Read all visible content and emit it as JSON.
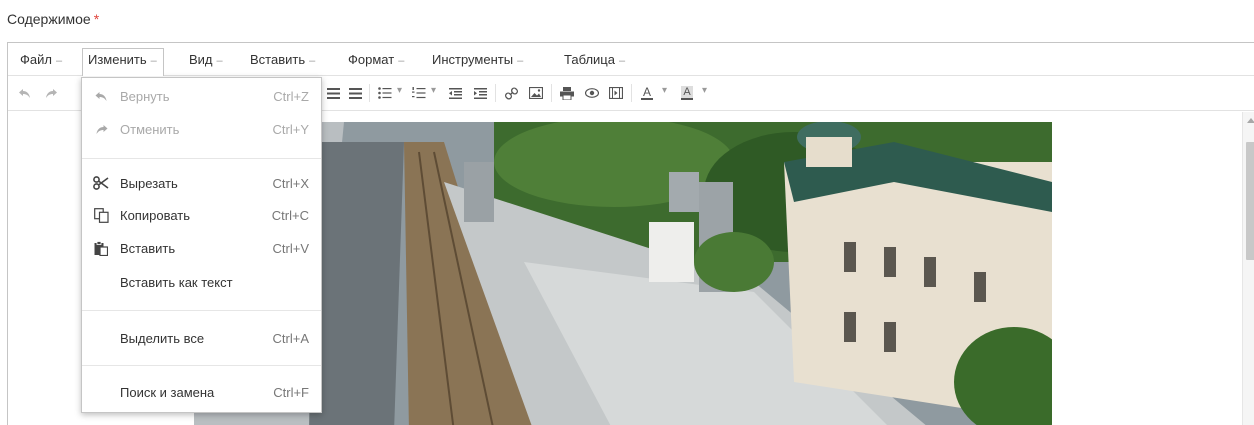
{
  "field": {
    "label": "Содержимое",
    "required_mark": "*"
  },
  "menubar": {
    "items": [
      {
        "label": "Файл",
        "caret": "–"
      },
      {
        "label": "Изменить",
        "caret": "–"
      },
      {
        "label": "Вид",
        "caret": "–"
      },
      {
        "label": "Вставить",
        "caret": "–"
      },
      {
        "label": "Формат",
        "caret": "–"
      },
      {
        "label": "Инструменты",
        "caret": "–"
      },
      {
        "label": "Таблица",
        "caret": "–"
      }
    ],
    "active": "Изменить"
  },
  "toolbar": {
    "buttons": [
      "undo-icon",
      "redo-icon",
      "align-justify-icon",
      "bullet-list-icon",
      "numbered-list-icon",
      "outdent-icon",
      "indent-icon",
      "link-icon",
      "image-icon",
      "print-icon",
      "preview-icon",
      "media-icon",
      "text-color-icon",
      "background-color-icon"
    ],
    "text_color_letter": "A",
    "bg_color_letter": "A"
  },
  "edit_menu": {
    "items": [
      {
        "label": "Вернуть",
        "shortcut": "Ctrl+Z",
        "icon": "undo-icon",
        "disabled": true
      },
      {
        "label": "Отменить",
        "shortcut": "Ctrl+Y",
        "icon": "redo-icon",
        "disabled": true
      },
      {
        "label": "Вырезать",
        "shortcut": "Ctrl+X",
        "icon": "scissors-icon",
        "disabled": false
      },
      {
        "label": "Копировать",
        "shortcut": "Ctrl+C",
        "icon": "copy-icon",
        "disabled": false
      },
      {
        "label": "Вставить",
        "shortcut": "Ctrl+V",
        "icon": "paste-icon",
        "disabled": false
      },
      {
        "label": "Вставить как текст",
        "shortcut": "",
        "icon": "",
        "disabled": false
      },
      {
        "label": "Выделить все",
        "shortcut": "Ctrl+A",
        "icon": "",
        "disabled": false
      },
      {
        "label": "Поиск и замена",
        "shortcut": "Ctrl+F",
        "icon": "",
        "disabled": false
      }
    ]
  },
  "colors": {
    "required": "#e0443c",
    "border": "#c5c5c5",
    "disabled_text": "#a9a9a9"
  }
}
